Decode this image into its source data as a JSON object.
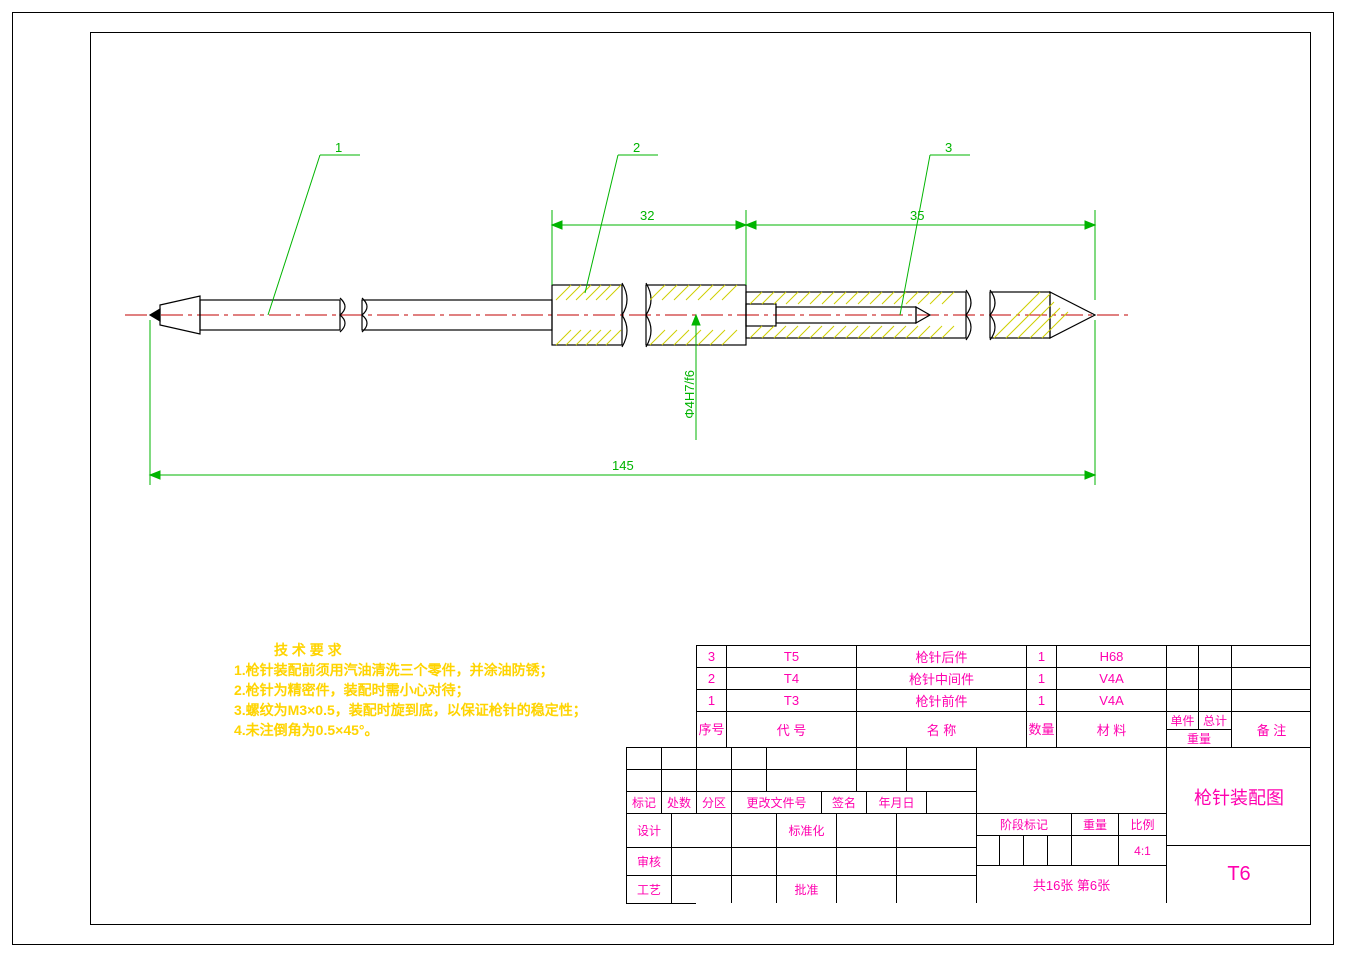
{
  "balloons": {
    "b1": "1",
    "b2": "2",
    "b3": "3"
  },
  "dims": {
    "d32": "32",
    "d35": "35",
    "d145": "145",
    "fit": "Φ4H7/f6"
  },
  "tech": {
    "title": "技 术 要 求",
    "l1": "1.枪针装配前须用汽油清洗三个零件，并涂油防锈；",
    "l2": "2.枪针为精密件，装配时需小心对待；",
    "l3": "3.螺纹为M3×0.5，装配时旋到底，以保证枪针的稳定性；",
    "l4": "4.未注倒角为0.5×45°。"
  },
  "bom": {
    "r3": {
      "no": "3",
      "code": "T5",
      "name": "枪针后件",
      "qty": "1",
      "mat": "H68"
    },
    "r2": {
      "no": "2",
      "code": "T4",
      "name": "枪针中间件",
      "qty": "1",
      "mat": "V4A"
    },
    "r1": {
      "no": "1",
      "code": "T3",
      "name": "枪针前件",
      "qty": "1",
      "mat": "V4A"
    },
    "hdr": {
      "no": "序号",
      "code": "代 号",
      "name": "名 称",
      "qty": "数量",
      "mat": "材 料",
      "unit": "单件",
      "total": "总计",
      "weight": "重量",
      "remark": "备 注"
    }
  },
  "tb": {
    "mark": "标记",
    "count": "处数",
    "zone": "分区",
    "docchg": "更改文件号",
    "sign": "签名",
    "date": "年月日",
    "design": "设计",
    "std": "标准化",
    "chk": "审核",
    "proc": "工艺",
    "approve": "批准",
    "stage": "阶段标记",
    "weight": "重量",
    "scale": "比例",
    "scaleval": "4:1",
    "sheets": "共16张  第6张",
    "title": "枪针装配图",
    "dwgno": "T6"
  }
}
